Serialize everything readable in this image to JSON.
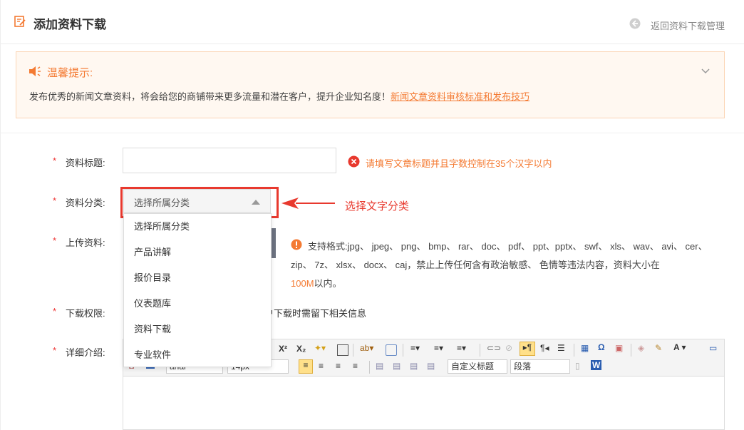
{
  "header": {
    "title": "添加资料下载",
    "back_label": "返回资料下载管理"
  },
  "tip": {
    "title": "温馨提示:",
    "body": "发布优秀的新闻文章资料，将会给您的商铺带来更多流量和潜在客户，提升企业知名度！",
    "link": "新闻文章资料审核标准和发布技巧"
  },
  "form": {
    "title_label": "资料标题:",
    "title_error": "请填写文章标题并且字数控制在35个汉字以内",
    "category_label": "资料分类:",
    "category_selected": "选择所属分类",
    "category_options": [
      "选择所属分类",
      "产品讲解",
      "报价目录",
      "仪表题库",
      "资料下载",
      "专业软件"
    ],
    "upload_label": "上传资料:",
    "support_prefix": "支持格式:",
    "support_text": "jpg、 jpeg、 png、 bmp、 rar、 doc、 pdf、 ppt、pptx、 swf、 xls、 wav、 avi、 cer、 zip、 7z、 xlsx、 docx、 caj，禁止上传任何含有政治敏感、 色情等违法内容，资料大小在",
    "support_size": "100M",
    "support_suffix": "以内。",
    "permission_label": "下载权限:",
    "permission_text": "户下载时需留下相关信息",
    "detail_label": "详细介绍:"
  },
  "annotation": {
    "text": "选择文字分类",
    "color": "#e8392e"
  },
  "editor": {
    "font_family": "arial",
    "font_size": "14px",
    "heading_select": "自定义标题",
    "paragraph_select": "段落"
  },
  "colors": {
    "accent": "#f47a32",
    "required": "#e33333",
    "highlight": "#e8392e"
  }
}
